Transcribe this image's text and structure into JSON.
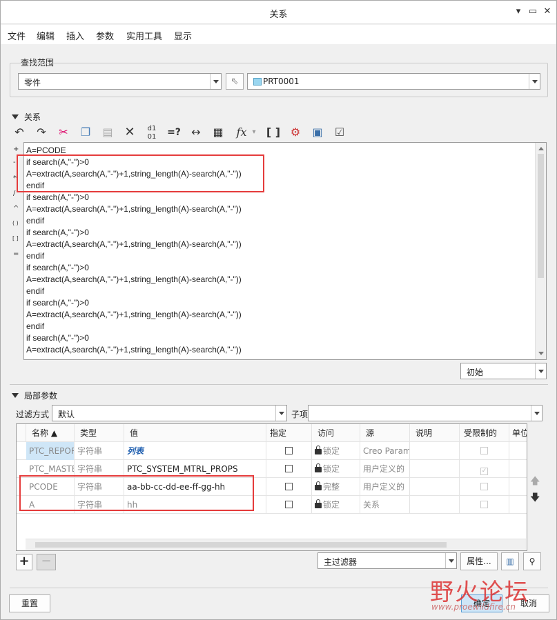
{
  "window": {
    "title": "关系",
    "buttons": [
      "minimize-icon",
      "restore-icon",
      "close-icon"
    ]
  },
  "menu": [
    "文件",
    "编辑",
    "插入",
    "参数",
    "实用工具",
    "显示"
  ],
  "scope": {
    "label": "查找范围",
    "type_value": "零件",
    "model_value": "PRT0001"
  },
  "relations": {
    "section_label": "关系",
    "toolbar_icons": [
      "undo-icon",
      "redo-icon",
      "cut-icon",
      "copy-icon",
      "paste-icon",
      "delete-icon",
      "units-icon",
      "evaluate-icon",
      "measure-icon",
      "properties-icon",
      "function-icon",
      "brackets-icon",
      "verify-icon",
      "sort-icon",
      "check-icon"
    ],
    "side_symbols": [
      "+",
      "-",
      "*",
      "/",
      "^",
      "( )",
      "[ ]",
      "="
    ],
    "lines": [
      "A=PCODE",
      "if search(A,\"-\")>0",
      "A=extract(A,search(A,\"-\")+1,string_length(A)-search(A,\"-\"))",
      "endif",
      "if search(A,\"-\")>0",
      "A=extract(A,search(A,\"-\")+1,string_length(A)-search(A,\"-\"))",
      "endif",
      "if search(A,\"-\")>0",
      "A=extract(A,search(A,\"-\")+1,string_length(A)-search(A,\"-\"))",
      "endif",
      "if search(A,\"-\")>0",
      "A=extract(A,search(A,\"-\")+1,string_length(A)-search(A,\"-\"))",
      "endif",
      "if search(A,\"-\")>0",
      "A=extract(A,search(A,\"-\")+1,string_length(A)-search(A,\"-\"))",
      "endif",
      "if search(A,\"-\")>0",
      "A=extract(A,search(A,\"-\")+1,string_length(A)-search(A,\"-\"))"
    ],
    "initial_value": "初始"
  },
  "params": {
    "section_label": "局部参数",
    "filter_label": "过滤方式",
    "filter_value": "默认",
    "subitem_label": "子项",
    "subitem_value": "",
    "columns": [
      "名称 ▲",
      "类型",
      "值",
      "指定",
      "访问",
      "源",
      "说明",
      "受限制的",
      "单位"
    ],
    "rows": [
      {
        "name": "PTC_REPORT",
        "type": "字符串",
        "value": "列表",
        "access": "锁定",
        "source": "Creo Parametric",
        "designated": false,
        "restricted": false
      },
      {
        "name": "PTC_MASTER",
        "type": "字符串",
        "value": "PTC_SYSTEM_MTRL_PROPS",
        "access": "锁定",
        "source": "用户定义的",
        "designated": false,
        "restricted": true
      },
      {
        "name": "PCODE",
        "type": "字符串",
        "value": "aa-bb-cc-dd-ee-ff-gg-hh",
        "access": "完整",
        "source": "用户定义的",
        "designated": false,
        "restricted": false
      },
      {
        "name": "A",
        "type": "字符串",
        "value": "hh",
        "access": "锁定",
        "source": "关系",
        "designated": false,
        "restricted": false
      }
    ],
    "main_filter": "主过滤器",
    "properties_button": "属性..."
  },
  "footer": {
    "reset": "重置",
    "ok": "确定",
    "cancel": "取消"
  },
  "watermark": {
    "text": "野火论坛",
    "url": "www.proewildfire.cn"
  },
  "accent_colors": {
    "highlight": "#e53b3b",
    "selected": "#cfe6f7"
  }
}
